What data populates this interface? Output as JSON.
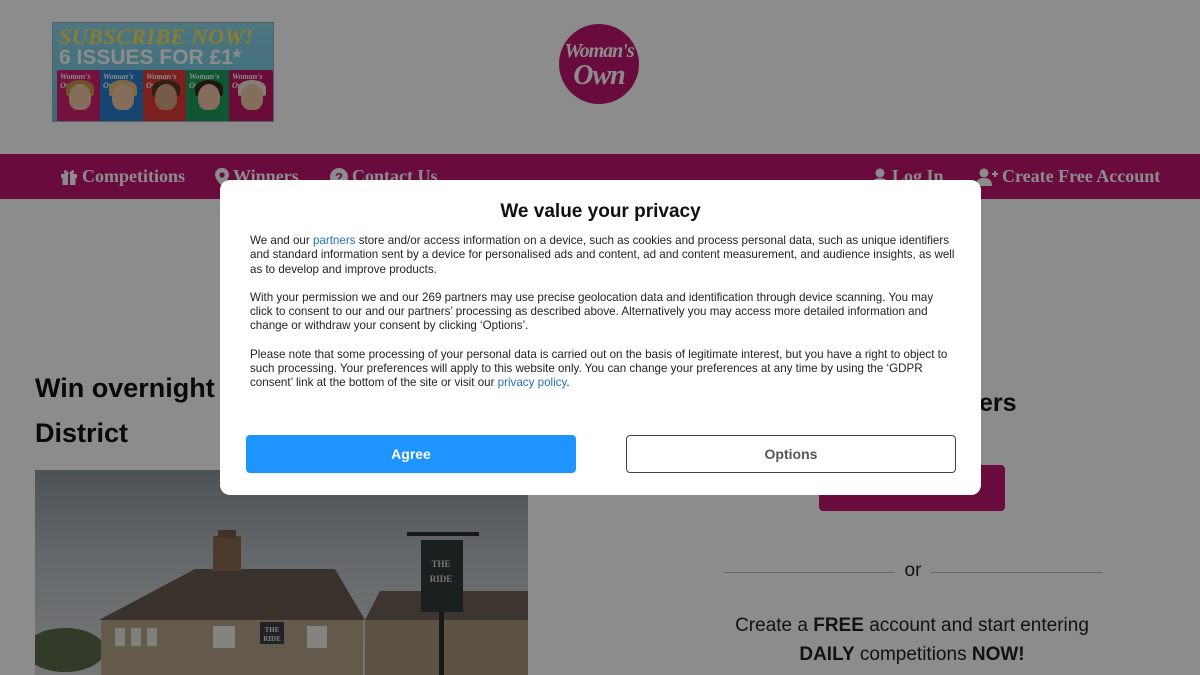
{
  "promo": {
    "headline": "SUBSCRIBE NOW!",
    "offer": "6 ISSUES FOR £1*",
    "magazine_cover_title": "Woman's Own"
  },
  "logo": {
    "line1": "Woman's",
    "line2": "Own"
  },
  "nav": {
    "competitions": "Competitions",
    "winners": "Winners",
    "contact": "Contact Us",
    "login": "Log In",
    "create_account": "Create Free Account"
  },
  "article": {
    "title_visible": "Win overnight",
    "title_line2": "District"
  },
  "sidebar": {
    "heading_visible": "ers",
    "or": "or",
    "promo_parts": [
      "Create a ",
      "FREE",
      " account and start entering ",
      "DAILY",
      " competitions ",
      "NOW!"
    ]
  },
  "consent": {
    "title": "We value your privacy",
    "p1_before": "We and our ",
    "p1_link": "partners",
    "p1_after": " store and/or access information on a device, such as cookies and process personal data, such as unique identifiers and standard information sent by a device for personalised ads and content, ad and content measurement, and audience insights, as well as to develop and improve products.",
    "p2": "With your permission we and our 269 partners may use precise geolocation data and identification through device scanning. You may click to consent to our and our partners’ processing as described above. Alternatively you may access more detailed information and change or withdraw your consent by clicking ‘Options’.",
    "p3_before": "Please note that some processing of your personal data is carried out on the basis of legitimate interest, but you have a right to object to such processing. Your preferences will apply to this website only. You can change your preferences at any time by using the ‘GDPR consent’ link at the bottom of the site or visit our ",
    "p3_link": "privacy policy",
    "p3_after": ".",
    "agree": "Agree",
    "options": "Options"
  },
  "colors": {
    "brand": "#c0176f",
    "agree_button": "#1e94ff",
    "link": "#1f6fc6"
  }
}
